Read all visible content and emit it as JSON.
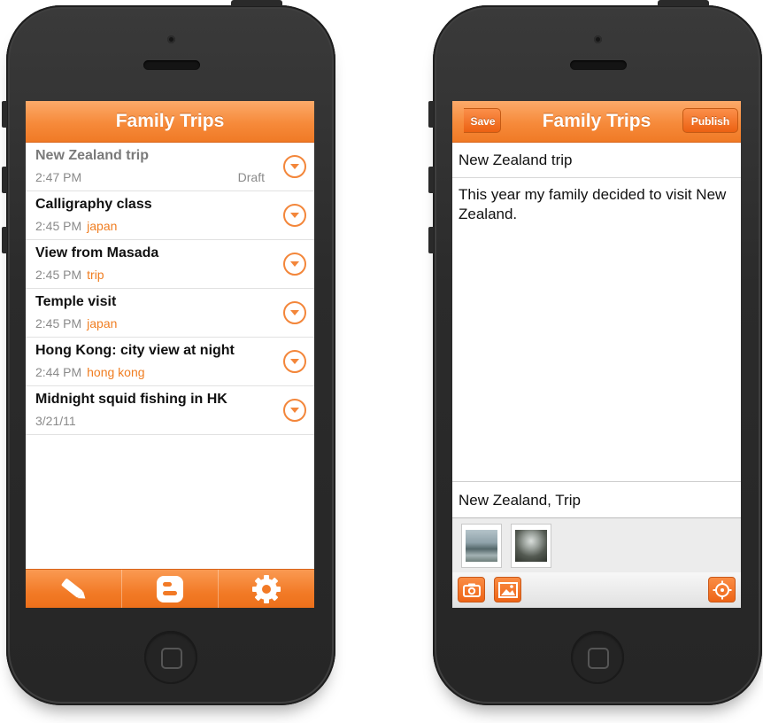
{
  "list_screen": {
    "title": "Family Trips",
    "posts": [
      {
        "title": "New Zealand trip",
        "time": "2:47 PM",
        "tag": "",
        "status": "Draft",
        "is_draft": true
      },
      {
        "title": "Calligraphy class",
        "time": "2:45 PM",
        "tag": "japan",
        "status": ""
      },
      {
        "title": "View from Masada",
        "time": "2:45 PM",
        "tag": "trip",
        "status": ""
      },
      {
        "title": "Temple visit",
        "time": "2:45 PM",
        "tag": "japan",
        "status": ""
      },
      {
        "title": "Hong Kong: city view at night",
        "time": "2:44 PM",
        "tag": "hong kong",
        "status": ""
      },
      {
        "title": "Midnight squid fishing in HK",
        "time": "3/21/11",
        "tag": "",
        "status": ""
      }
    ],
    "tabs": [
      {
        "icon": "pencil-icon"
      },
      {
        "icon": "blogger-icon"
      },
      {
        "icon": "gear-icon"
      }
    ]
  },
  "editor_screen": {
    "title": "Family Trips",
    "save_label": "Save",
    "publish_label": "Publish",
    "post_title": "New Zealand trip",
    "post_body": "This year my family decided to visit New Zealand.",
    "labels": "New Zealand, Trip",
    "thumbnails": [
      "coast-photo",
      "tree-photo"
    ],
    "toolbar_icons": [
      "camera-icon",
      "image-icon",
      "location-icon"
    ]
  },
  "colors": {
    "accent": "#f68a3a",
    "tag": "#f07e22",
    "draft_title": "#7a7a7a"
  }
}
